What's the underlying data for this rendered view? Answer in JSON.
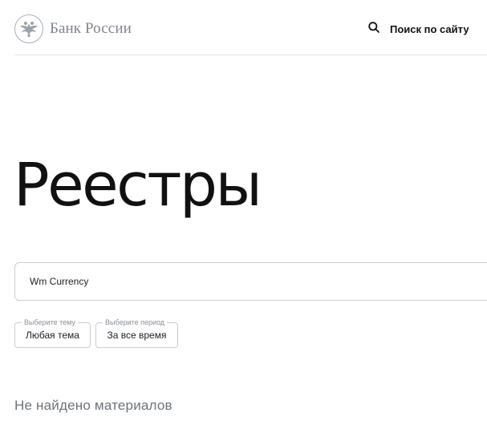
{
  "header": {
    "logo_text": "Банк России",
    "search_label": "Поиск по сайту"
  },
  "page": {
    "title": "Реестры"
  },
  "search": {
    "value": "Wm Currency"
  },
  "filters": {
    "topic": {
      "legend": "Выберите тему",
      "value": "Любая тема"
    },
    "period": {
      "legend": "Выберите период",
      "value": "За все время"
    }
  },
  "results": {
    "empty_text": "Не найдено материалов"
  },
  "icons": {
    "logo": "double-headed-eagle-icon",
    "search": "search-icon"
  },
  "colors": {
    "logo_gray": "#7f858d",
    "border": "#c9cdd2",
    "muted_text": "#6d737a"
  }
}
